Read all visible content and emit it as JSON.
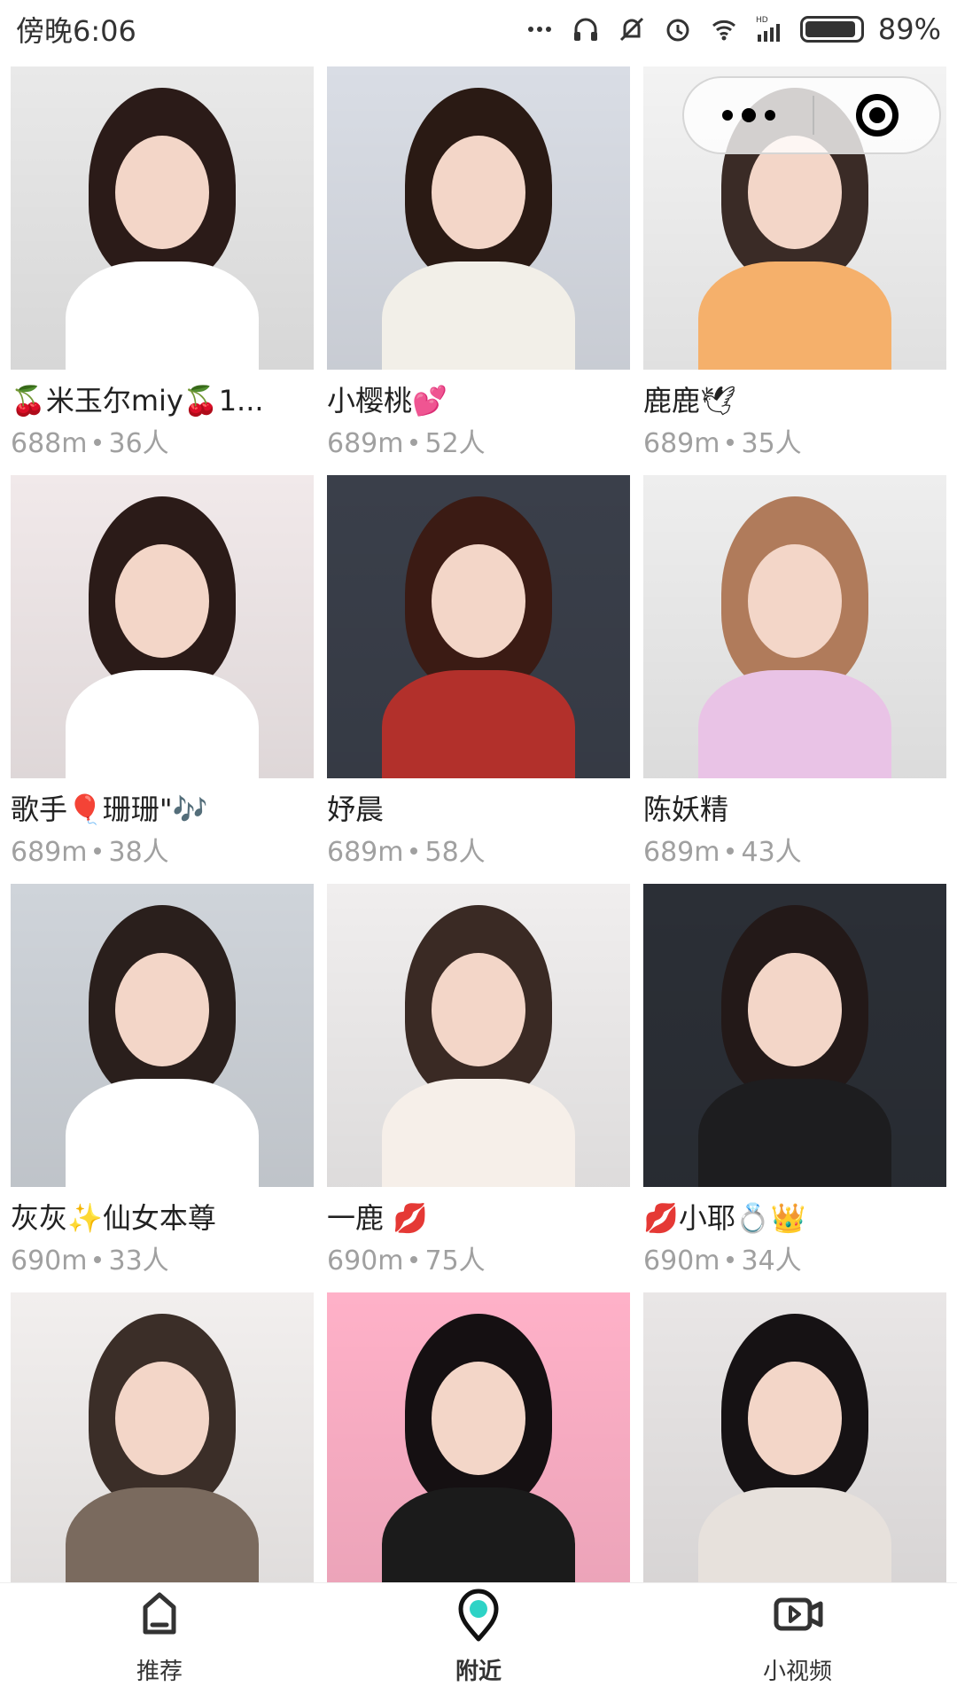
{
  "status_bar": {
    "time": "傍晚6:06",
    "battery": "89%",
    "icons": [
      "more-dots-icon",
      "headphones-icon",
      "mute-bell-icon",
      "alarm-icon",
      "wifi-icon",
      "hd-signal-icon",
      "battery-icon"
    ]
  },
  "capsule": {
    "more_icon": "more-dots-icon",
    "close_icon": "target-close-icon"
  },
  "colors": {
    "accent": "#2ED3C6",
    "text": "#222222",
    "meta": "#A0A0A0",
    "tab_border": "#EEEEEE"
  },
  "cards": [
    {
      "name": "🍒米玉尔miy🍒1...",
      "distance": "688m",
      "count": "36人",
      "photo_bg": "#e9e9e9",
      "hair": "#2b1b18",
      "body": "#ffffff"
    },
    {
      "name": "小樱桃💕",
      "distance": "689m",
      "count": "52人",
      "photo_bg": "#d9dde5",
      "hair": "#2a1a14",
      "body": "#f2efe8"
    },
    {
      "name": "鹿鹿🕊",
      "distance": "689m",
      "count": "35人",
      "photo_bg": "#f3f3f3",
      "hair": "#3a2b26",
      "body": "#f5b06b"
    },
    {
      "name": "歌手🎈珊珊\"🎶",
      "distance": "689m",
      "count": "38人",
      "photo_bg": "#f1e9ea",
      "hair": "#2b1b18",
      "body": "#ffffff"
    },
    {
      "name": "妤晨",
      "distance": "689m",
      "count": "58人",
      "photo_bg": "#3a3f4a",
      "hair": "#3b1b14",
      "body": "#b2302b"
    },
    {
      "name": "陈妖精",
      "distance": "689m",
      "count": "43人",
      "photo_bg": "#eeeeee",
      "hair": "#b07b5b",
      "body": "#e9c3e6"
    },
    {
      "name": "灰灰✨仙女本尊",
      "distance": "690m",
      "count": "33人",
      "photo_bg": "#cfd4da",
      "hair": "#2a1f1c",
      "body": "#ffffff"
    },
    {
      "name": "一鹿 💋",
      "distance": "690m",
      "count": "75人",
      "photo_bg": "#f0eeee",
      "hair": "#3a2a24",
      "body": "#f6efe9"
    },
    {
      "name": "💋小耶💍👑",
      "distance": "690m",
      "count": "34人",
      "photo_bg": "#2b2f36",
      "hair": "#231918",
      "body": "#1d1d1f"
    },
    {
      "name": "",
      "distance": "",
      "count": "",
      "photo_bg": "#f2efee",
      "hair": "#3b2e28",
      "body": "#7a6a5e"
    },
    {
      "name": "",
      "distance": "",
      "count": "",
      "photo_bg": "#ffb1c8",
      "hair": "#151012",
      "body": "#1b1b1b"
    },
    {
      "name": "",
      "distance": "",
      "count": "",
      "photo_bg": "#e9e6e6",
      "hair": "#161214",
      "body": "#e7e1dc"
    }
  ],
  "tabs": [
    {
      "label": "推荐",
      "icon": "home-icon",
      "active": false
    },
    {
      "label": "附近",
      "icon": "location-icon",
      "active": true
    },
    {
      "label": "小视频",
      "icon": "video-icon",
      "active": false
    }
  ]
}
